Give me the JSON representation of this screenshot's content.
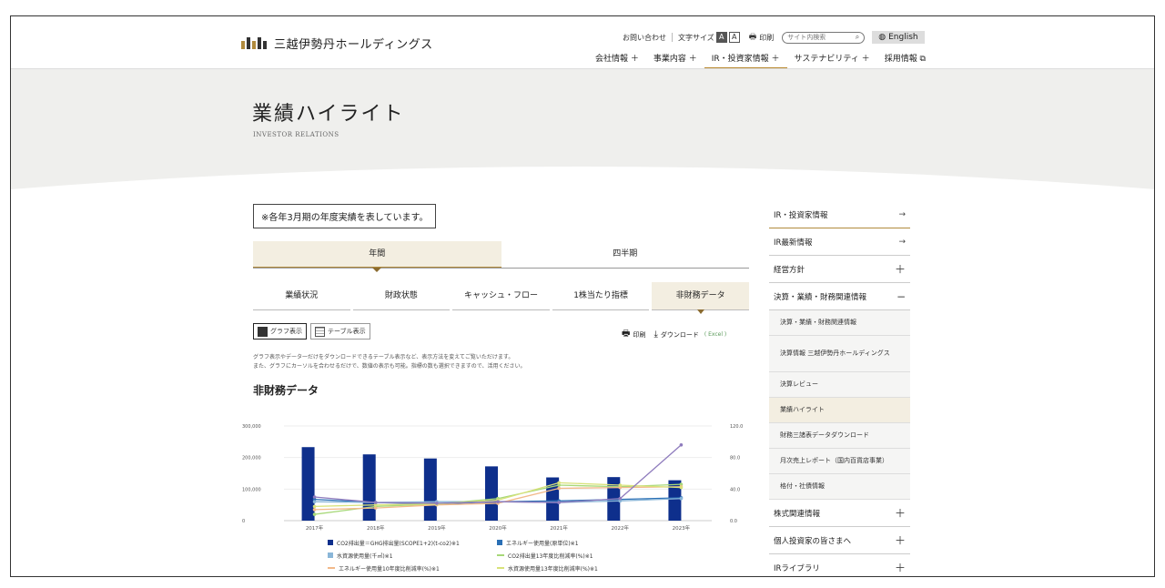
{
  "header": {
    "logo_text": "三越伊勢丹ホールディングス",
    "contact": "お問い合わせ",
    "font_size_label": "文字サイズ",
    "size_large": "A",
    "size_small": "A",
    "print": "印刷",
    "search_placeholder": "サイト内検索",
    "english": "English",
    "nav": [
      {
        "label": "会社情報 ＋"
      },
      {
        "label": "事業内容 ＋"
      },
      {
        "label": "IR・投資家情報 ＋"
      },
      {
        "label": "サステナビリティ ＋"
      },
      {
        "label": "採用情報 ⧉"
      }
    ]
  },
  "hero": {
    "title": "業績ハイライト",
    "subtitle": "INVESTOR RELATIONS"
  },
  "notice": "※各年3月期の年度実績を表しています。",
  "period_tabs": [
    {
      "label": "年間"
    },
    {
      "label": "四半期"
    }
  ],
  "sub_tabs": [
    {
      "label": "業績状況"
    },
    {
      "label": "財政状態"
    },
    {
      "label": "キャッシュ・フロー"
    },
    {
      "label": "1株当たり指標"
    },
    {
      "label": "非財務データ"
    }
  ],
  "view": {
    "graph": "グラフ表示",
    "table": "テーブル表示"
  },
  "tools": {
    "print": "印刷",
    "download": "ダウンロード",
    "excel": "( Excel )"
  },
  "description": {
    "line1": "グラフ表示やデータ一だけをダウンロードできるテーブル表示など、表示方法を変えてご覧いただけます。",
    "line2": "また、グラフにカーソルを合わせるだけで、数値の表示も可能。指標の数も選択できますので、活用ください。"
  },
  "section_title": "非財務データ",
  "colors": {
    "accent": "#b08a3c",
    "bar": "#0e2f8c"
  },
  "chart_data": {
    "type": "bar",
    "categories": [
      "2017年",
      "2018年",
      "2019年",
      "2020年",
      "2021年",
      "2022年",
      "2023年"
    ],
    "y_left_ticks": [
      "300,000",
      "200,000",
      "100,000",
      "0"
    ],
    "y_right_ticks": [
      "120.0",
      "80.0",
      "40.0",
      "0.0"
    ],
    "ylim_left": [
      0,
      300000
    ],
    "ylim_right": [
      0,
      120
    ],
    "series": [
      {
        "name": "CO2排出量＝GHG排出量(SCOPE1+2)(t-co2)※1",
        "type": "bar",
        "axis": "left",
        "color": "#0e2f8c",
        "values": [
          233000,
          210000,
          197000,
          172000,
          137000,
          138000,
          128000
        ]
      },
      {
        "name": "エネルギー使用量(原単位)※1",
        "type": "line",
        "axis": "right",
        "color": "#2a6fb5",
        "values": [
          27,
          23,
          21,
          24,
          25,
          27,
          29
        ]
      },
      {
        "name": "水資源使用量(千㎥)※1",
        "type": "line",
        "axis": "right",
        "color": "#8ab6d8",
        "values": [
          24,
          23,
          24,
          24,
          23,
          25,
          28
        ]
      },
      {
        "name": "CO2排出量13年度比削減率(%)※1",
        "type": "line",
        "axis": "right",
        "color": "#a7d878",
        "values": [
          8,
          18,
          21,
          28,
          45,
          43,
          46
        ]
      },
      {
        "name": "エネルギー使用量10年度比削減率(%)※1",
        "type": "line",
        "axis": "right",
        "color": "#f2b98a",
        "values": [
          14,
          16,
          20,
          22,
          41,
          42,
          43
        ]
      },
      {
        "name": "水資源使用量13年度比削減率(%)※1",
        "type": "line",
        "axis": "right",
        "color": "#d8e27a",
        "values": [
          18,
          20,
          21,
          26,
          48,
          45,
          42
        ]
      },
      {
        "name": "",
        "type": "line",
        "axis": "right",
        "color": "#8e7bbd",
        "values": [
          30,
          23,
          22,
          24,
          23,
          28,
          96
        ]
      }
    ]
  },
  "sidebar": {
    "items": [
      {
        "label": "IR・投資家情報",
        "mark": "→"
      },
      {
        "label": "IR最新情報",
        "mark": "→"
      },
      {
        "label": "経営方針",
        "mark": "＋"
      },
      {
        "label": "決算・業績・財務関連情報",
        "mark": "−"
      }
    ],
    "subs": [
      {
        "label": "決算・業績・財務関連情報"
      },
      {
        "label": "決算情報 三越伊勢丹ホールディングス"
      },
      {
        "label": "決算レビュー"
      },
      {
        "label": "業績ハイライト"
      },
      {
        "label": "財務三諸表データダウンロード"
      },
      {
        "label": "月次売上レポート（国内百貨店事業）"
      },
      {
        "label": "格付・社債情報"
      }
    ],
    "after": [
      {
        "label": "株式関連情報",
        "mark": "＋"
      },
      {
        "label": "個人投資家の皆さまへ",
        "mark": "＋"
      },
      {
        "label": "IRライブラリ",
        "mark": "＋"
      }
    ]
  }
}
